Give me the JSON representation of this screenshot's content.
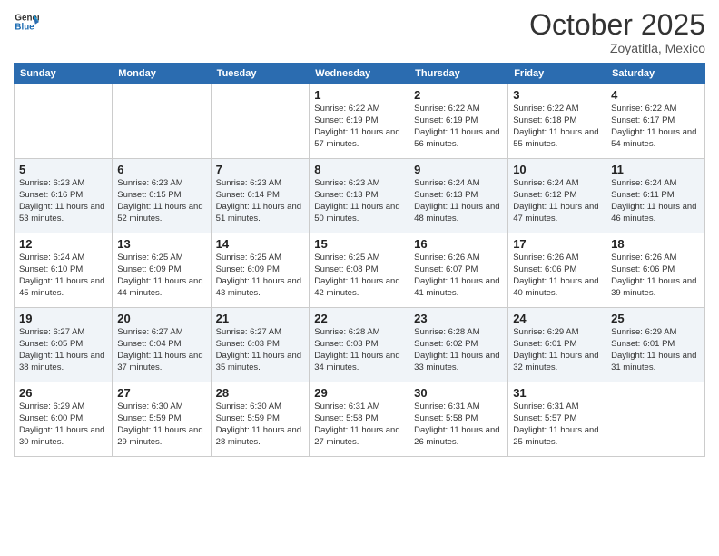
{
  "header": {
    "logo_line1": "General",
    "logo_line2": "Blue",
    "month": "October 2025",
    "location": "Zoyatitla, Mexico"
  },
  "days_of_week": [
    "Sunday",
    "Monday",
    "Tuesday",
    "Wednesday",
    "Thursday",
    "Friday",
    "Saturday"
  ],
  "weeks": [
    [
      {
        "day": "",
        "info": ""
      },
      {
        "day": "",
        "info": ""
      },
      {
        "day": "",
        "info": ""
      },
      {
        "day": "1",
        "info": "Sunrise: 6:22 AM\nSunset: 6:19 PM\nDaylight: 11 hours and 57 minutes."
      },
      {
        "day": "2",
        "info": "Sunrise: 6:22 AM\nSunset: 6:19 PM\nDaylight: 11 hours and 56 minutes."
      },
      {
        "day": "3",
        "info": "Sunrise: 6:22 AM\nSunset: 6:18 PM\nDaylight: 11 hours and 55 minutes."
      },
      {
        "day": "4",
        "info": "Sunrise: 6:22 AM\nSunset: 6:17 PM\nDaylight: 11 hours and 54 minutes."
      }
    ],
    [
      {
        "day": "5",
        "info": "Sunrise: 6:23 AM\nSunset: 6:16 PM\nDaylight: 11 hours and 53 minutes."
      },
      {
        "day": "6",
        "info": "Sunrise: 6:23 AM\nSunset: 6:15 PM\nDaylight: 11 hours and 52 minutes."
      },
      {
        "day": "7",
        "info": "Sunrise: 6:23 AM\nSunset: 6:14 PM\nDaylight: 11 hours and 51 minutes."
      },
      {
        "day": "8",
        "info": "Sunrise: 6:23 AM\nSunset: 6:13 PM\nDaylight: 11 hours and 50 minutes."
      },
      {
        "day": "9",
        "info": "Sunrise: 6:24 AM\nSunset: 6:13 PM\nDaylight: 11 hours and 48 minutes."
      },
      {
        "day": "10",
        "info": "Sunrise: 6:24 AM\nSunset: 6:12 PM\nDaylight: 11 hours and 47 minutes."
      },
      {
        "day": "11",
        "info": "Sunrise: 6:24 AM\nSunset: 6:11 PM\nDaylight: 11 hours and 46 minutes."
      }
    ],
    [
      {
        "day": "12",
        "info": "Sunrise: 6:24 AM\nSunset: 6:10 PM\nDaylight: 11 hours and 45 minutes."
      },
      {
        "day": "13",
        "info": "Sunrise: 6:25 AM\nSunset: 6:09 PM\nDaylight: 11 hours and 44 minutes."
      },
      {
        "day": "14",
        "info": "Sunrise: 6:25 AM\nSunset: 6:09 PM\nDaylight: 11 hours and 43 minutes."
      },
      {
        "day": "15",
        "info": "Sunrise: 6:25 AM\nSunset: 6:08 PM\nDaylight: 11 hours and 42 minutes."
      },
      {
        "day": "16",
        "info": "Sunrise: 6:26 AM\nSunset: 6:07 PM\nDaylight: 11 hours and 41 minutes."
      },
      {
        "day": "17",
        "info": "Sunrise: 6:26 AM\nSunset: 6:06 PM\nDaylight: 11 hours and 40 minutes."
      },
      {
        "day": "18",
        "info": "Sunrise: 6:26 AM\nSunset: 6:06 PM\nDaylight: 11 hours and 39 minutes."
      }
    ],
    [
      {
        "day": "19",
        "info": "Sunrise: 6:27 AM\nSunset: 6:05 PM\nDaylight: 11 hours and 38 minutes."
      },
      {
        "day": "20",
        "info": "Sunrise: 6:27 AM\nSunset: 6:04 PM\nDaylight: 11 hours and 37 minutes."
      },
      {
        "day": "21",
        "info": "Sunrise: 6:27 AM\nSunset: 6:03 PM\nDaylight: 11 hours and 35 minutes."
      },
      {
        "day": "22",
        "info": "Sunrise: 6:28 AM\nSunset: 6:03 PM\nDaylight: 11 hours and 34 minutes."
      },
      {
        "day": "23",
        "info": "Sunrise: 6:28 AM\nSunset: 6:02 PM\nDaylight: 11 hours and 33 minutes."
      },
      {
        "day": "24",
        "info": "Sunrise: 6:29 AM\nSunset: 6:01 PM\nDaylight: 11 hours and 32 minutes."
      },
      {
        "day": "25",
        "info": "Sunrise: 6:29 AM\nSunset: 6:01 PM\nDaylight: 11 hours and 31 minutes."
      }
    ],
    [
      {
        "day": "26",
        "info": "Sunrise: 6:29 AM\nSunset: 6:00 PM\nDaylight: 11 hours and 30 minutes."
      },
      {
        "day": "27",
        "info": "Sunrise: 6:30 AM\nSunset: 5:59 PM\nDaylight: 11 hours and 29 minutes."
      },
      {
        "day": "28",
        "info": "Sunrise: 6:30 AM\nSunset: 5:59 PM\nDaylight: 11 hours and 28 minutes."
      },
      {
        "day": "29",
        "info": "Sunrise: 6:31 AM\nSunset: 5:58 PM\nDaylight: 11 hours and 27 minutes."
      },
      {
        "day": "30",
        "info": "Sunrise: 6:31 AM\nSunset: 5:58 PM\nDaylight: 11 hours and 26 minutes."
      },
      {
        "day": "31",
        "info": "Sunrise: 6:31 AM\nSunset: 5:57 PM\nDaylight: 11 hours and 25 minutes."
      },
      {
        "day": "",
        "info": ""
      }
    ]
  ]
}
